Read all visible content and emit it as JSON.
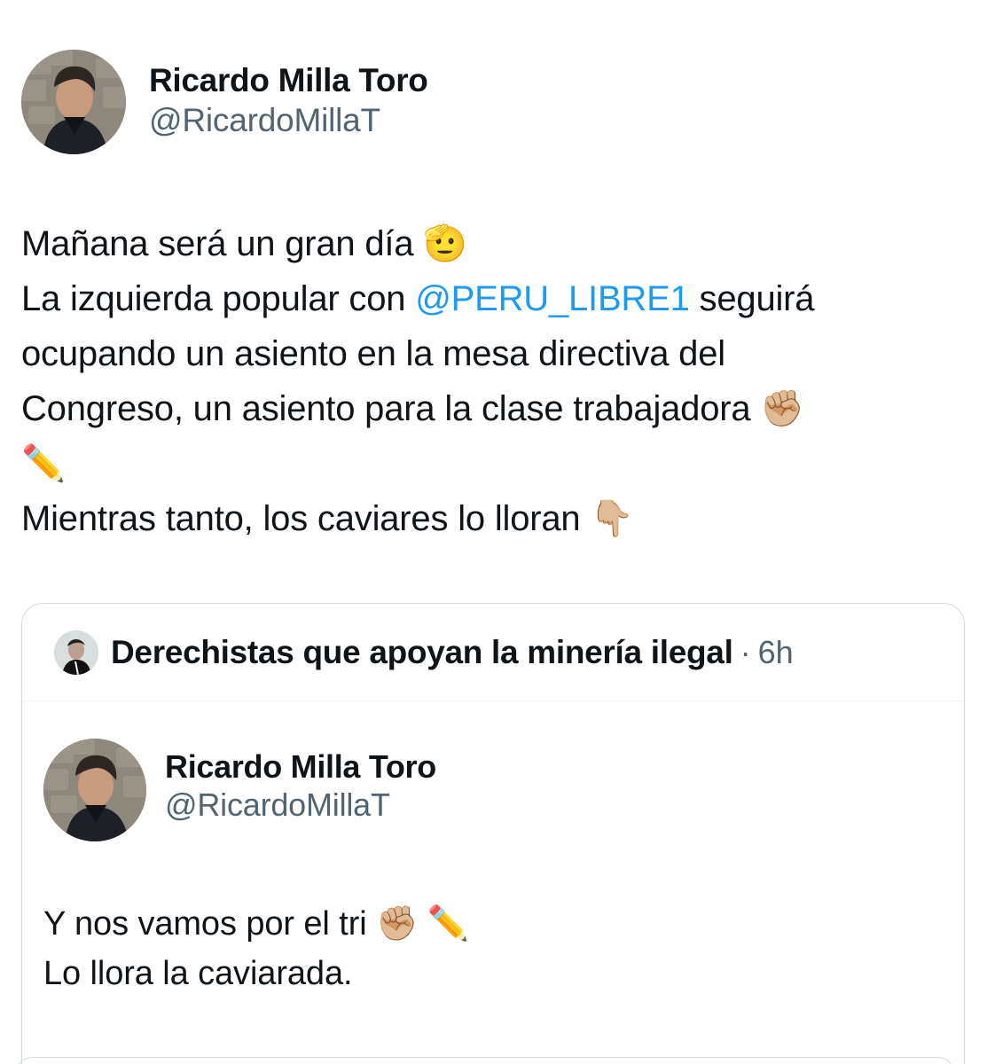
{
  "tweet": {
    "author": {
      "display_name": "Ricardo Milla Toro",
      "handle": "@RicardoMillaT",
      "avatar": "profile-photo"
    },
    "text_lines": {
      "line1": "Mañana será un gran día",
      "line1_emoji": "🫡",
      "line2_prefix": "La izquierda popular con ",
      "line2_mention": "@PERU_LIBRE1",
      "line2_suffix": " seguirá",
      "line3": "ocupando un asiento en la mesa directiva del",
      "line4": "Congreso, un asiento para la clase trabajadora",
      "line4_emoji": "✊🏼",
      "line5_emoji": "✏️",
      "line6": "Mientras tanto, los caviares lo lloran",
      "line6_emoji": "👇🏼"
    }
  },
  "quote": {
    "header": {
      "display_name": "Derechistas que apoyan la minería ilegal",
      "separator": "·",
      "time": "6h",
      "avatar": "profile-photo"
    },
    "author": {
      "display_name": "Ricardo Milla Toro",
      "handle": "@RicardoMillaT",
      "avatar": "profile-photo"
    },
    "text_lines": {
      "line1": "Y nos vamos por el tri",
      "line1_emoji_1": "✊🏼",
      "line1_emoji_2": "✏️",
      "line2": "Lo llora la caviarada."
    }
  },
  "colors": {
    "text": "#0f1419",
    "secondary_text": "#536471",
    "mention": "#1d9bf0",
    "border": "#cfd9de"
  }
}
